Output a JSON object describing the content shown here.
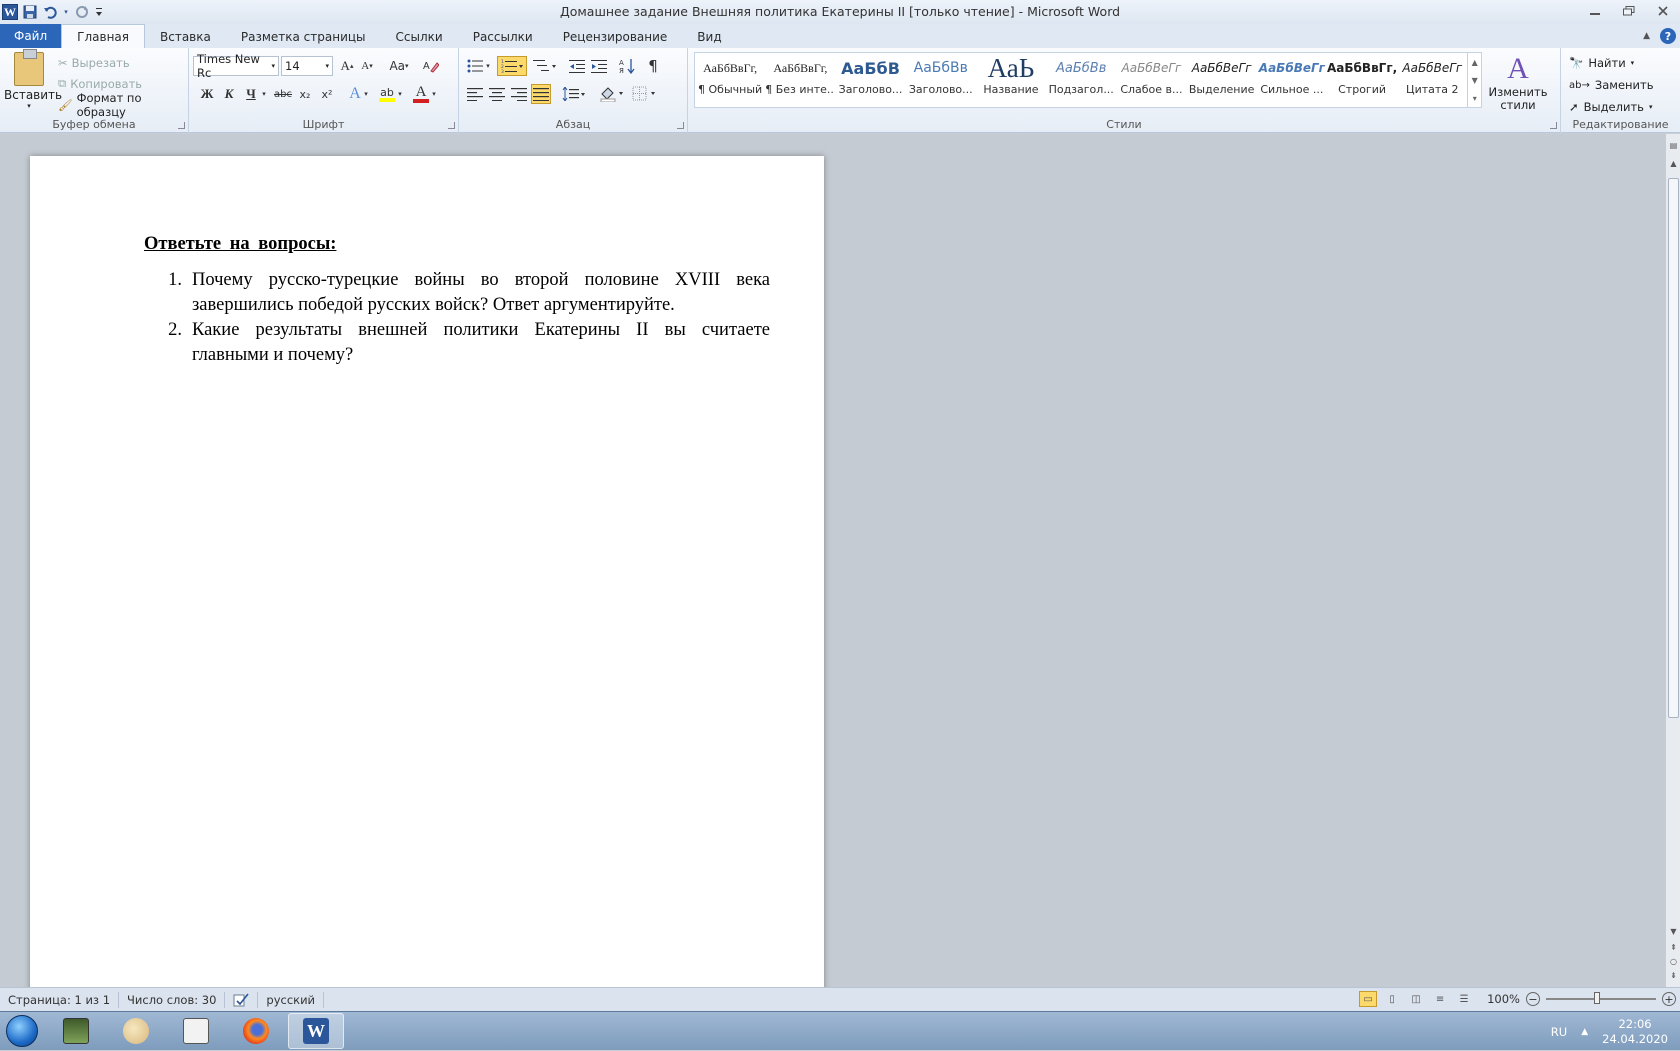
{
  "window": {
    "title": "Домашнее задание Внешняя политика Екатерины II [только чтение]  -  Microsoft Word",
    "buttons": [
      "minimize",
      "restore",
      "close"
    ]
  },
  "quick_access": {
    "icons": [
      "word-logo",
      "save-icon",
      "undo-icon",
      "redo-icon",
      "customize-icon"
    ],
    "logo_letter": "W"
  },
  "tabs": {
    "file": "Файл",
    "items": [
      "Главная",
      "Вставка",
      "Разметка страницы",
      "Ссылки",
      "Рассылки",
      "Рецензирование",
      "Вид"
    ],
    "active": "Главная",
    "help": "?"
  },
  "ribbon": {
    "clipboard": {
      "label": "Буфер обмена",
      "paste": "Вставить",
      "cut": "Вырезать",
      "copy": "Копировать",
      "format_painter": "Формат по образцу"
    },
    "font": {
      "label": "Шрифт",
      "font_name": "Times New Rc",
      "font_size": "14",
      "grow": "A",
      "shrink": "A",
      "change_case": "Aa",
      "bold": "Ж",
      "italic": "К",
      "underline": "Ч",
      "strike": "abc",
      "subscript": "x₂",
      "superscript": "x²",
      "text_effects": "A",
      "highlight": "ab",
      "font_color": "A",
      "font_color_hex": "#d22020",
      "highlight_hex": "#ffff00"
    },
    "paragraph": {
      "label": "Абзац",
      "pilcrow": "¶"
    },
    "styles": {
      "label": "Стили",
      "items": [
        {
          "preview": "АаБбВвГг,",
          "name": "¶ Обычный"
        },
        {
          "preview": "АаБбВвГг,",
          "name": "¶ Без инте..."
        },
        {
          "preview": "АаБбВ",
          "name": "Заголово..."
        },
        {
          "preview": "АаБбВв",
          "name": "Заголово..."
        },
        {
          "preview": "АаЬ",
          "name": "Название"
        },
        {
          "preview": "АаБбВв",
          "name": "Подзагол..."
        },
        {
          "preview": "АаБбВеГг",
          "name": "Слабое в..."
        },
        {
          "preview": "АаБбВеГг",
          "name": "Выделение"
        },
        {
          "preview": "АаБбВеГг",
          "name": "Сильное ..."
        },
        {
          "preview": "АаБбВвГг,",
          "name": "Строгий"
        },
        {
          "preview": "АаБбВеГг",
          "name": "Цитата 2"
        }
      ],
      "change_styles": "Изменить стили",
      "change_styles_glyph": "A"
    },
    "editing": {
      "label": "Редактирование",
      "find": "Найти",
      "replace": "Заменить",
      "select": "Выделить"
    }
  },
  "document": {
    "heading": "Ответьте  на  вопросы:",
    "questions": [
      {
        "num": "1.",
        "text": "Почему русско-турецкие  войны во  второй половине  XVIII  века завершились победой русских войск?  Ответ  аргументируйте."
      },
      {
        "num": "2.",
        "text": "Какие  результаты  внешней  политики  Екатерины  II  вы  считаете главными и почему?"
      }
    ]
  },
  "statusbar": {
    "page": "Страница: 1 из 1",
    "words": "Число слов: 30",
    "language": "русский",
    "zoom": "100%",
    "zoom_minus": "−",
    "zoom_plus": "+"
  },
  "taskbar": {
    "apps": [
      "computer-app-icon",
      "paint-app-icon",
      "calculator-app-icon",
      "firefox-app-icon",
      "word-app-icon"
    ],
    "active_app": "word-app-icon",
    "lang": "RU",
    "time": "22:06",
    "date": "24.04.2020"
  }
}
